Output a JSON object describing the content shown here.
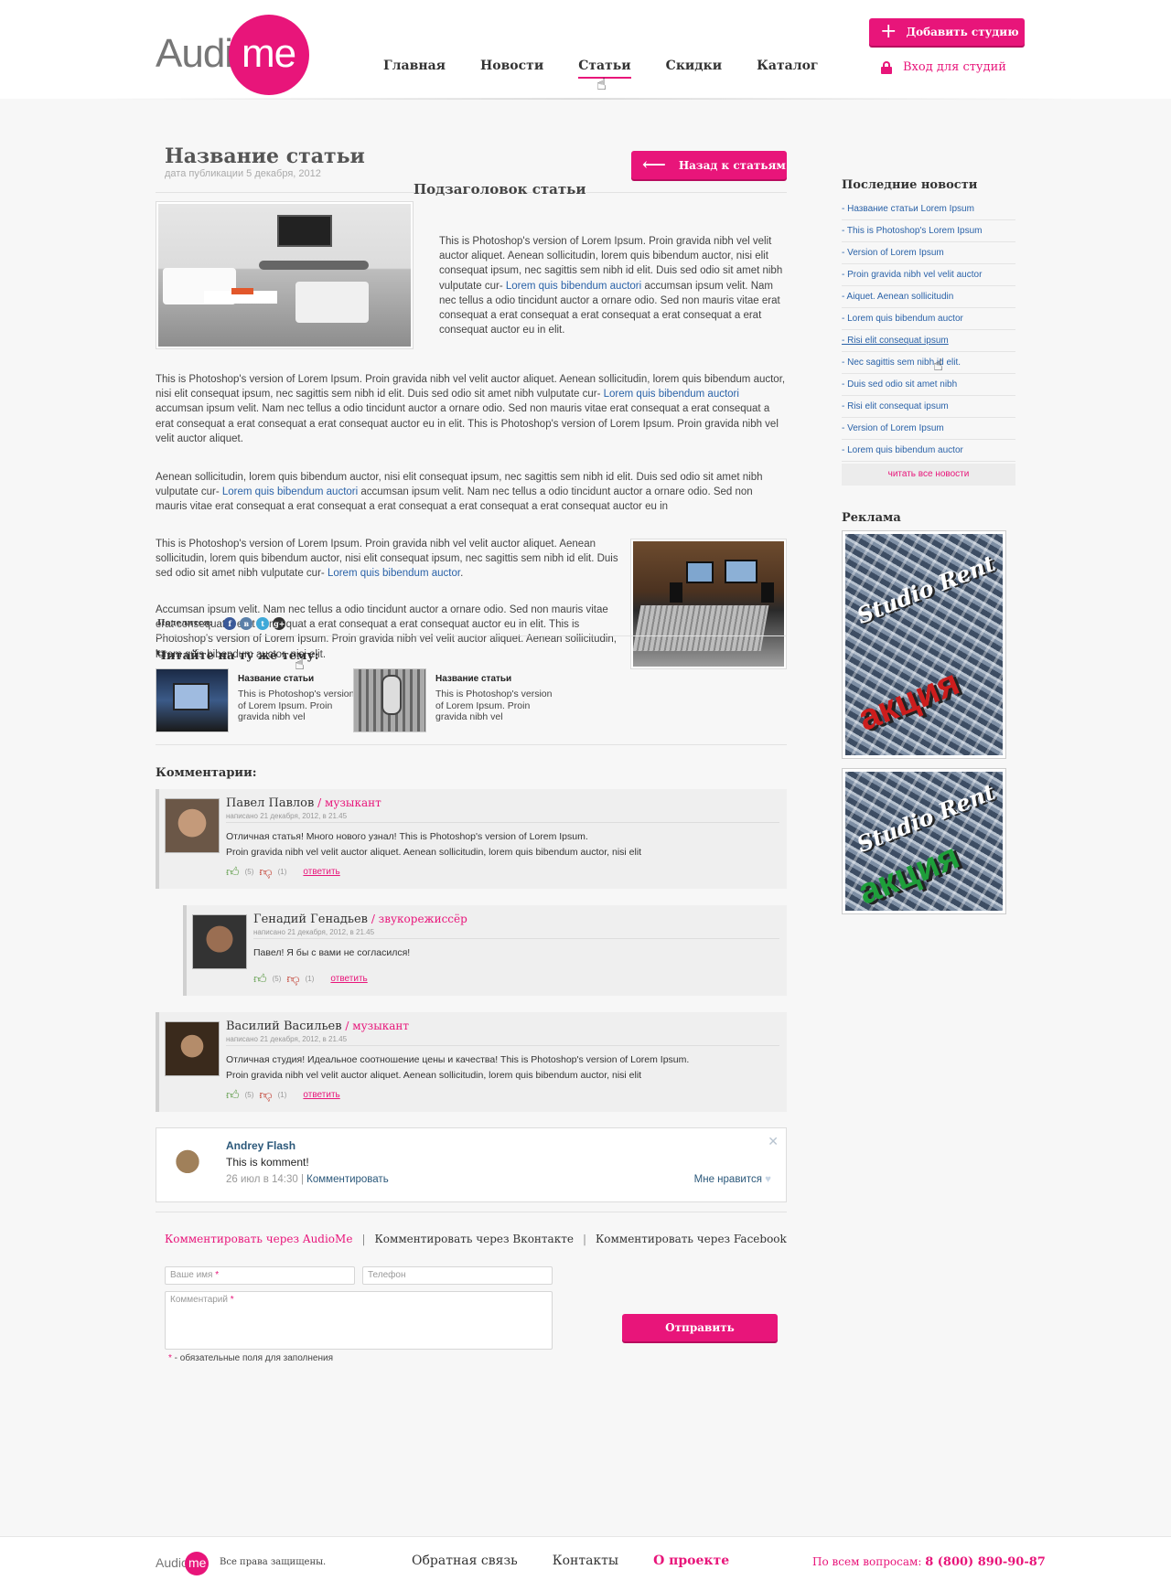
{
  "header": {
    "logo_left": "Audio",
    "logo_right": "me",
    "nav": [
      {
        "label": "Главная",
        "active": false
      },
      {
        "label": "Новости",
        "active": false
      },
      {
        "label": "Статьи",
        "active": true
      },
      {
        "label": "Скидки",
        "active": false
      },
      {
        "label": "Каталог",
        "active": false
      }
    ],
    "add_studio_label": "Добавить студию",
    "login_label": "Вход для студий"
  },
  "article": {
    "title": "Название статьи",
    "date": "дата публикации 5 декабря, 2012",
    "back_label": "Назад к статьям",
    "subtitle": "Подзаголовок статьи",
    "p1_a": "This is Photoshop's version  of Lorem Ipsum. Proin gravida nibh vel velit auctor aliquet. Aenean sollicitudin, lorem quis bibendum auctor, nisi elit consequat ipsum, nec sagittis sem nibh id elit. Duis sed odio sit amet nibh vulputate cur- ",
    "p1_link": "Lorem quis bibendum auctori",
    "p1_b": " accumsan ipsum velit. Nam nec tellus a odio tincidunt auctor a ornare odio. Sed non  mauris vitae erat consequat a erat consequat a erat consequat a erat consequat a erat consequat auctor eu in elit.",
    "p2_a": "This is Photoshop's version  of Lorem Ipsum. Proin gravida nibh vel velit auctor aliquet. Aenean sollicitudin, lorem quis bibendum auctor, nisi elit consequat ipsum, nec sagittis sem nibh id elit. Duis sed odio sit amet nibh vulputate cur- ",
    "p2_link": "Lorem quis bibendum auctori",
    "p2_b": " accumsan ipsum velit. Nam nec tellus a odio tincidunt auctor a ornare odio. Sed non  mauris vitae erat consequat a erat consequat a erat consequat a erat consequat a erat consequat auctor eu in elit. This is Photoshop's version  of Lorem Ipsum. Proin gravida nibh vel velit auctor aliquet.",
    "p3_a": "Aenean sollicitudin, lorem quis bibendum auctor, nisi elit consequat ipsum, nec sagittis sem nibh id elit. Duis sed odio sit amet nibh vulputate cur- ",
    "p3_link": "Lorem quis bibendum auctori",
    "p3_b": " accumsan ipsum velit. Nam nec tellus a odio tincidunt auctor a ornare odio. Sed non  mauris vitae erat consequat a erat consequat a erat consequat a erat consequat a erat consequat auctor eu in",
    "p4_a": "This is Photoshop's version  of Lorem Ipsum. Proin gravida nibh vel velit auctor aliquet. Aenean sollicitudin, lorem quis bibendum auctor, nisi elit consequat ipsum, nec sagittis sem nibh id elit. Duis sed odio sit amet nibh vulputate cur- ",
    "p4_link": "Lorem quis bibendum auctor",
    "p4_b": ".",
    "p5": "Accumsan ipsum velit. Nam nec tellus a odio tincidunt auctor a ornare odio. Sed non  mauris vitae erat consequat a erat consequat a erat consequat a erat consequat auctor eu in elit. This is Photoshop's version  of Lorem Ipsum. Proin gravida nibh vel velit auctor aliquet. Aenean sollicitudin, lorem quis bibendum auctor, nisi elit.",
    "share_label": "Поделится:",
    "share_icons": [
      "f",
      "в",
      "t",
      "g+"
    ],
    "related_title": "Читайте на ту же тему:",
    "related": [
      {
        "name": "Название статьи",
        "text": "This is Photoshop's version  of Lorem Ipsum. Proin gravida nibh vel"
      },
      {
        "name": "Название статьи",
        "text": "This is Photoshop's version  of Lorem Ipsum. Proin gravida nibh vel"
      }
    ]
  },
  "comments": {
    "title": "Комментарии:",
    "items": [
      {
        "name": "Павел Павлов",
        "role": " / музыкант",
        "meta": "написано 21 декабря, 2012, в 21.45",
        "line1": "Отличная статья! Много нового узнал! This is Photoshop's version  of Lorem Ipsum.",
        "line2": "Proin gravida nibh vel velit auctor aliquet. Aenean sollicitudin, lorem quis bibendum auctor, nisi elit",
        "likes": "(5)",
        "dislikes": "(1)",
        "reply": "ответить"
      },
      {
        "name": "Генадий Генадьев",
        "role": " / звукорежиссёр",
        "meta": "написано 21 декабря, 2012, в 21.45",
        "line1": "Павел! Я бы с вами не согласился!",
        "line2": "",
        "likes": "(5)",
        "dislikes": "(1)",
        "reply": "ответить"
      },
      {
        "name": "Василий Васильев",
        "role": " / музыкант",
        "meta": "написано 21 декабря, 2012, в 21.45",
        "line1": "Отличная студия! Идеальное соотношение цены и качества! This is Photoshop's version  of Lorem Ipsum.",
        "line2": "Proin gravida nibh vel velit auctor aliquet. Aenean sollicitudin, lorem quis bibendum auctor, nisi elit",
        "likes": "(5)",
        "dislikes": "(1)",
        "reply": "ответить"
      }
    ],
    "vk": {
      "name": "Andrey Flash",
      "text": "This is komment!",
      "date": "26 июл в 14:30",
      "sep": " | ",
      "comment_link": "Комментировать",
      "like_label": "Мне нравится"
    },
    "via_audiome": "Комментировать через AudioMe",
    "via_vk": "Комментировать через Вконтакте",
    "via_fb": "Комментировать через Facebook",
    "via_sep": "|",
    "form": {
      "name_ph": "Ваше имя",
      "phone_ph": "Телефон",
      "comment_ph": "Комментарий",
      "req_mark": "*",
      "send_label": "Отправить",
      "req_note": " - обязательные поля для заполнения"
    }
  },
  "sidebar": {
    "news_title": "Последние новости",
    "news": [
      "- Название статьи Lorem Ipsum",
      "- This is Photoshop's Lorem Ipsum",
      "- Version of Lorem Ipsum",
      "- Proin gravida nibh vel velit auctor",
      "- Aiquet. Aenean sollicitudin",
      "- Lorem quis bibendum auctor",
      "- Risi elit consequat ipsum",
      "- Nec sagittis sem nibh id elit.",
      "- Duis sed odio sit amet nibh",
      "- Risi elit consequat ipsum",
      "- Version of Lorem Ipsum",
      "- Lorem quis bibendum auctor"
    ],
    "all_news": "читать все новости",
    "ads_title": "Реклама",
    "ad_text1": "Studio Rent",
    "ad_text2": "акция",
    "ad_colors": [
      "#cc1d1d",
      "#1e9e3a"
    ]
  },
  "footer": {
    "logo_left": "Audio",
    "logo_right": "me",
    "rights": "Все права защищены.",
    "links": [
      "Обратная связь",
      "Контакты",
      "О проекте"
    ],
    "phone_label": "По всем вопросам: ",
    "phone": "8 (800) 890-90-87"
  },
  "colors": {
    "accent": "#e8157a",
    "link": "#2a62a8"
  }
}
